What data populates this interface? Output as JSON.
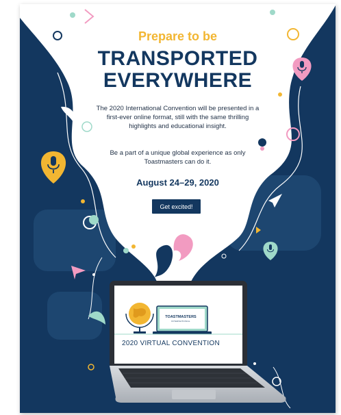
{
  "promo": {
    "eyebrow": "Prepare to be",
    "headline_line1": "TRANSPORTED",
    "headline_line2": "EVERYWHERE",
    "body_paragraph_1": "The 2020 International Convention will be presented in a first-ever online format, still with the same thrilling highlights and educational insight.",
    "body_paragraph_2": "Be a part of a unique global experience as only Toastmasters can do it.",
    "dates": "August 24–29, 2020",
    "cta_label": "Get excited!",
    "laptop_screen_caption": "2020 VIRTUAL CONVENTION",
    "laptop_brand": "TOASTMASTERS",
    "laptop_brand_sub": "INTERNATIONAL"
  },
  "colors": {
    "navy": "#13375f",
    "gold": "#f2b632",
    "pink": "#f29bc1",
    "mint": "#9fd9c9",
    "white": "#ffffff"
  },
  "icons": [
    "microphone-pin-icon",
    "paper-plane-icon",
    "globe-icon",
    "laptop-icon",
    "play-triangle-icon"
  ]
}
